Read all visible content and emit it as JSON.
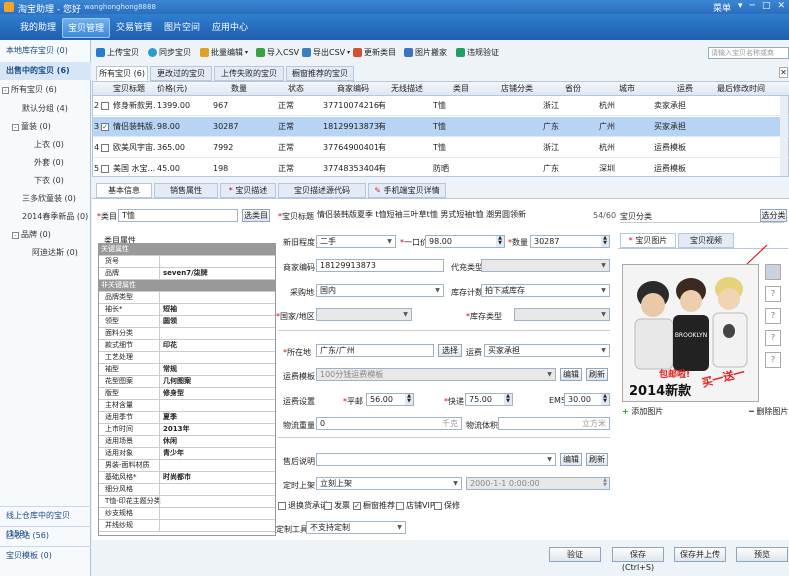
{
  "app": {
    "title": "淘宝助理 - 您好",
    "user": "wanghonghong8888",
    "menu": "菜单",
    "controls": [
      "▾",
      "─",
      "□",
      "✕"
    ]
  },
  "nav": [
    "我的助理",
    "宝贝管理",
    "交易管理",
    "图片空间",
    "应用中心"
  ],
  "sidebar": {
    "local": "本地库存宝贝 (0)",
    "selling": "出售中的宝贝 (6)",
    "tree": [
      {
        "label": "所有宝贝 (6)",
        "level": 0,
        "toggle": "-"
      },
      {
        "label": "默认分组 (4)",
        "level": 1,
        "toggle": ""
      },
      {
        "label": "童装 (0)",
        "level": 1,
        "toggle": "-"
      },
      {
        "label": "上衣 (0)",
        "level": 2,
        "toggle": ""
      },
      {
        "label": "外套 (0)",
        "level": 2,
        "toggle": ""
      },
      {
        "label": "下衣 (0)",
        "level": 2,
        "toggle": ""
      },
      {
        "label": "三多欣童装 (0)",
        "level": 1,
        "toggle": ""
      },
      {
        "label": "2014春季新品 (0)",
        "level": 1,
        "toggle": ""
      },
      {
        "label": "品牌 (0)",
        "level": 1,
        "toggle": "-"
      },
      {
        "label": "阿迪达斯 (0)",
        "level": 2,
        "toggle": ""
      }
    ],
    "bottom": [
      "线上仓库中的宝贝 (159)",
      "回收站 (56)",
      "宝贝模板 (0)"
    ]
  },
  "toolbar": [
    {
      "label": "上传宝贝",
      "color": "#2a7bd0"
    },
    {
      "label": "同步宝贝",
      "color": "#2a9bd0"
    },
    {
      "label": "批量编辑",
      "color": "#e0a020"
    },
    {
      "label": "导入CSV",
      "color": "#3aa040"
    },
    {
      "label": "导出CSV",
      "color": "#3a80c0"
    },
    {
      "label": "更新类目",
      "color": "#d05030"
    },
    {
      "label": "图片搬家",
      "color": "#4070c0"
    },
    {
      "label": "违规验证",
      "color": "#20a060"
    }
  ],
  "search_placeholder": "请输入宝贝名称或商",
  "list_tabs": [
    "所有宝贝 (6)",
    "更改过的宝贝 (0)",
    "上传失败的宝贝 (0)",
    "橱窗推荐的宝贝 (6)"
  ],
  "grid": {
    "headers": [
      "宝贝标题",
      "价格(元)",
      "数量",
      "状态",
      "商家编码",
      "无线描述",
      "类目",
      "店铺分类",
      "省份",
      "城市",
      "运费",
      "最后修改时间"
    ],
    "rows": [
      {
        "no": "2",
        "title": "修身新款男...",
        "price": "1399.00",
        "qty": "967",
        "status": "正常",
        "code": "37710074216",
        "wireless": "有",
        "cat": "T恤",
        "shopcat": "",
        "prov": "浙江",
        "city": "杭州",
        "ship": "卖家承担",
        "time": "",
        "checked": false
      },
      {
        "no": "3",
        "title": "情侣装韩版...",
        "price": "98.00",
        "qty": "30287",
        "status": "正常",
        "code": "18129913873",
        "wireless": "有",
        "cat": "T恤",
        "shopcat": "",
        "prov": "广东",
        "city": "广州",
        "ship": "买家承担",
        "time": "",
        "checked": true
      },
      {
        "no": "4",
        "title": "欧美风宇宙...",
        "price": "365.00",
        "qty": "7992",
        "status": "正常",
        "code": "37764900401",
        "wireless": "有",
        "cat": "T恤",
        "shopcat": "",
        "prov": "浙江",
        "city": "杭州",
        "ship": "运费模板",
        "time": "",
        "checked": false
      },
      {
        "no": "5",
        "title": "美国 水宝...",
        "price": "45.00",
        "qty": "198",
        "status": "正常",
        "code": "37748353404",
        "wireless": "有",
        "cat": "防晒",
        "shopcat": "",
        "prov": "广东",
        "city": "深圳",
        "ship": "运费模板",
        "time": "",
        "checked": false
      }
    ]
  },
  "edit_tabs": [
    "基本信息",
    "销售属性",
    "宝贝描述",
    "宝贝描述源代码",
    "手机端宝贝详情"
  ],
  "form": {
    "category_label": "类目",
    "category_value": "T恤",
    "choose_category": "选类目",
    "props_title": "类目属性",
    "title_label": "宝贝标题",
    "title_value": "情侣装韩版夏季 t恤短袖三叶草t恤 男式短袖t恤 潮男圆领新",
    "title_count": "54/60",
    "shopcat_label": "宝贝分类",
    "choose_shopcat": "选分类",
    "cond_label": "新旧程度",
    "cond_value": "二手",
    "price_label": "一口价",
    "price_value": "98.00",
    "qty_label": "数量",
    "qty_value": "30287",
    "code_label": "商家编码",
    "code_value": "18129913873",
    "sale_code_label": "代充类型",
    "origin_label": "采购地",
    "origin_value": "国内",
    "stock_label": "库存计数",
    "stock_value": "拍下减库存",
    "country_label": "国家/地区",
    "stock_type_label": "库存类型",
    "loc_label": "所在地",
    "loc_value": "广东/广州",
    "loc_btn": "选择",
    "fee_label": "运费",
    "fee_value": "买家承担",
    "tpl_label": "运费模板",
    "tpl_value": "100分钱运费模板",
    "edit": "编辑",
    "refresh": "刷新",
    "fee_set_label": "运费设置",
    "post_label": "平邮",
    "post_value": "56.00",
    "express_label": "快递",
    "express_value": "75.00",
    "ems_label": "EMS",
    "ems_value": "30.00",
    "weight_label": "物流重量",
    "weight_value": "0",
    "weight_unit": "千克",
    "volume_label": "物流体积",
    "volume_unit": "立方米",
    "after_label": "售后说明",
    "list_label": "定时上架",
    "list_value": "立刻上架",
    "list_time": "2000-1-1 0:00:00",
    "checks": [
      {
        "label": "退换货承诺",
        "checked": false
      },
      {
        "label": "发票",
        "checked": false
      },
      {
        "label": "橱窗推荐",
        "checked": true
      },
      {
        "label": "店铺VIP",
        "checked": false
      },
      {
        "label": "保修",
        "checked": false
      }
    ],
    "custom_label": "定制工具",
    "custom_value": "不支持定制",
    "pic_tabs": [
      "宝贝图片",
      "宝贝视频"
    ],
    "photo_caption": "2014新款",
    "add_pic": "添加图片",
    "del_pic": "删除图片",
    "thumbs": [
      "?",
      "?",
      "?",
      "?"
    ]
  },
  "props": [
    {
      "k": "关键属性",
      "v": "",
      "grp": true
    },
    {
      "k": "货号",
      "v": ""
    },
    {
      "k": "品牌",
      "v": "seven7/柒牌"
    },
    {
      "k": "非关键属性",
      "v": "",
      "grp": true
    },
    {
      "k": "品牌类型",
      "v": ""
    },
    {
      "k": "袖长*",
      "v": "短袖"
    },
    {
      "k": "领型",
      "v": "圆领"
    },
    {
      "k": "面料分类",
      "v": ""
    },
    {
      "k": "款式细节",
      "v": "印花"
    },
    {
      "k": "工艺处理",
      "v": ""
    },
    {
      "k": "袖型",
      "v": "常规"
    },
    {
      "k": "花型图案",
      "v": "几何图案"
    },
    {
      "k": "版型",
      "v": "修身型"
    },
    {
      "k": "主材含量",
      "v": ""
    },
    {
      "k": "适用季节",
      "v": "夏季"
    },
    {
      "k": "上市时间",
      "v": "2013年"
    },
    {
      "k": "适用场景",
      "v": "休闲"
    },
    {
      "k": "适用对象",
      "v": "青少年"
    },
    {
      "k": "男装-面料材质",
      "v": ""
    },
    {
      "k": "基础风格*",
      "v": "时尚都市"
    },
    {
      "k": "细分风格",
      "v": ""
    },
    {
      "k": "T恤-印花主题分类",
      "v": ""
    },
    {
      "k": "纱支规格",
      "v": ""
    },
    {
      "k": "并线纱规",
      "v": ""
    }
  ],
  "bottom_buttons": [
    "验证",
    "保存 (Ctrl+S)",
    "保存并上传",
    "预览"
  ]
}
